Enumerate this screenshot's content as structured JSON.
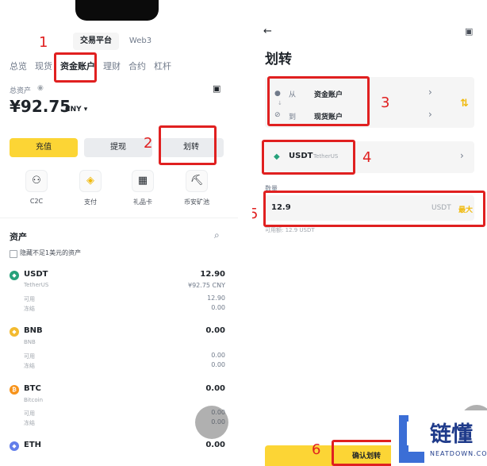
{
  "left": {
    "top_tabs": [
      "交易平台",
      "Web3"
    ],
    "nav_tabs": [
      "总览",
      "现货",
      "资金账户",
      "理财",
      "合约",
      "杠杆"
    ],
    "total_assets_label": "总资产",
    "total_value": "¥92.75",
    "currency": "CNY",
    "buttons": {
      "deposit": "充值",
      "withdraw": "提现",
      "transfer": "划转"
    },
    "quick_actions": [
      "C2C",
      "支付",
      "礼品卡",
      "币安矿池"
    ],
    "assets_title": "资产",
    "hide_small_label": "隐藏不足1美元的资产",
    "available_label": "可用",
    "frozen_label": "冻结",
    "assets": [
      {
        "symbol": "USDT",
        "name": "TetherUS",
        "total": "12.90",
        "cny": "¥92.75 CNY",
        "available": "12.90",
        "frozen": "0.00"
      },
      {
        "symbol": "BNB",
        "name": "BNB",
        "total": "0.00",
        "available": "0.00",
        "frozen": "0.00"
      },
      {
        "symbol": "BTC",
        "name": "Bitcoin",
        "total": "0.00",
        "available": "0.00",
        "frozen": "0.00"
      },
      {
        "symbol": "ETH",
        "total": "0.00"
      }
    ]
  },
  "right": {
    "title": "划转",
    "from_label": "从",
    "from_account": "资金账户",
    "to_label": "到",
    "to_account": "现货账户",
    "coin_symbol": "USDT",
    "coin_name": "TetherUS",
    "amount_label": "数量",
    "amount_value": "12.9",
    "amount_unit": "USDT",
    "max_label": "最大",
    "available_hint": "可用额: 12.9 USDT",
    "confirm_label": "确认划转"
  },
  "annotations": [
    "1",
    "2",
    "3",
    "4",
    "5",
    "6"
  ],
  "watermark": {
    "brand": "链懂",
    "url": "NEATDOWN.COM"
  },
  "colors": {
    "accent": "#fcd535",
    "annotation": "#e02020",
    "usdt": "#26a17b",
    "bnb": "#f3ba2f",
    "btc": "#f7931a",
    "eth": "#627eea"
  }
}
